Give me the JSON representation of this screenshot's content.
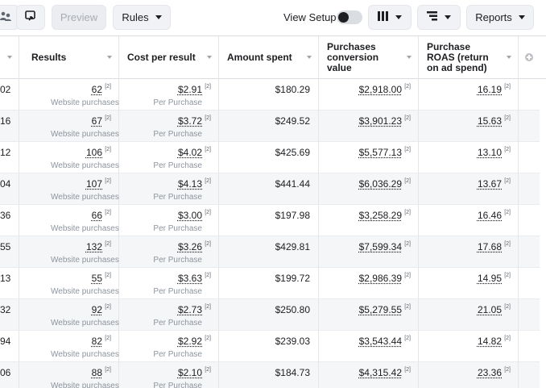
{
  "toolbar": {
    "preview_label": "Preview",
    "rules_label": "Rules",
    "view_setup_label": "View Setup",
    "reports_label": "Reports"
  },
  "columns": {
    "results": "Results",
    "cost_per_result": "Cost per result",
    "amount_spent": "Amount spent",
    "purchases_conversion_value": "Purchases conversion value",
    "purchase_roas": "Purchase ROAS (return on ad spend)"
  },
  "rows": [
    {
      "prev": "02",
      "results": "62",
      "results_sub": "Website purchases",
      "cost": "$2.91",
      "cost_sub": "Per Purchase",
      "amount": "$180.29",
      "conv": "$2,918.00",
      "roas": "16.19",
      "ref": "[2]"
    },
    {
      "prev": "16",
      "results": "67",
      "results_sub": "Website purchases",
      "cost": "$3.72",
      "cost_sub": "Per Purchase",
      "amount": "$249.52",
      "conv": "$3,901.23",
      "roas": "15.63",
      "ref": "[2]"
    },
    {
      "prev": "12",
      "results": "106",
      "results_sub": "Website purchases",
      "cost": "$4.02",
      "cost_sub": "Per Purchase",
      "amount": "$425.69",
      "conv": "$5,577.13",
      "roas": "13.10",
      "ref": "[2]"
    },
    {
      "prev": "04",
      "results": "107",
      "results_sub": "Website purchases",
      "cost": "$4.13",
      "cost_sub": "Per Purchase",
      "amount": "$441.44",
      "conv": "$6,036.29",
      "roas": "13.67",
      "ref": "[2]"
    },
    {
      "prev": "36",
      "results": "66",
      "results_sub": "Website purchases",
      "cost": "$3.00",
      "cost_sub": "Per Purchase",
      "amount": "$197.98",
      "conv": "$3,258.29",
      "roas": "16.46",
      "ref": "[2]"
    },
    {
      "prev": "55",
      "results": "132",
      "results_sub": "Website purchases",
      "cost": "$3.26",
      "cost_sub": "Per Purchase",
      "amount": "$429.81",
      "conv": "$7,599.34",
      "roas": "17.68",
      "ref": "[2]"
    },
    {
      "prev": "13",
      "results": "55",
      "results_sub": "Website purchases",
      "cost": "$3.63",
      "cost_sub": "Per Purchase",
      "amount": "$199.72",
      "conv": "$2,986.39",
      "roas": "14.95",
      "ref": "[2]"
    },
    {
      "prev": "32",
      "results": "92",
      "results_sub": "Website purchases",
      "cost": "$2.73",
      "cost_sub": "Per Purchase",
      "amount": "$250.80",
      "conv": "$5,279.55",
      "roas": "21.05",
      "ref": "[2]"
    },
    {
      "prev": "94",
      "results": "82",
      "results_sub": "Website purchases",
      "cost": "$2.92",
      "cost_sub": "Per Purchase",
      "amount": "$239.03",
      "conv": "$3,543.44",
      "roas": "14.82",
      "ref": "[2]"
    },
    {
      "prev": "06",
      "results": "88",
      "results_sub": "Website purchases",
      "cost": "$2.10",
      "cost_sub": "Per Purchase",
      "amount": "$184.73",
      "conv": "$4,315.42",
      "roas": "23.36",
      "ref": "[2]"
    }
  ]
}
